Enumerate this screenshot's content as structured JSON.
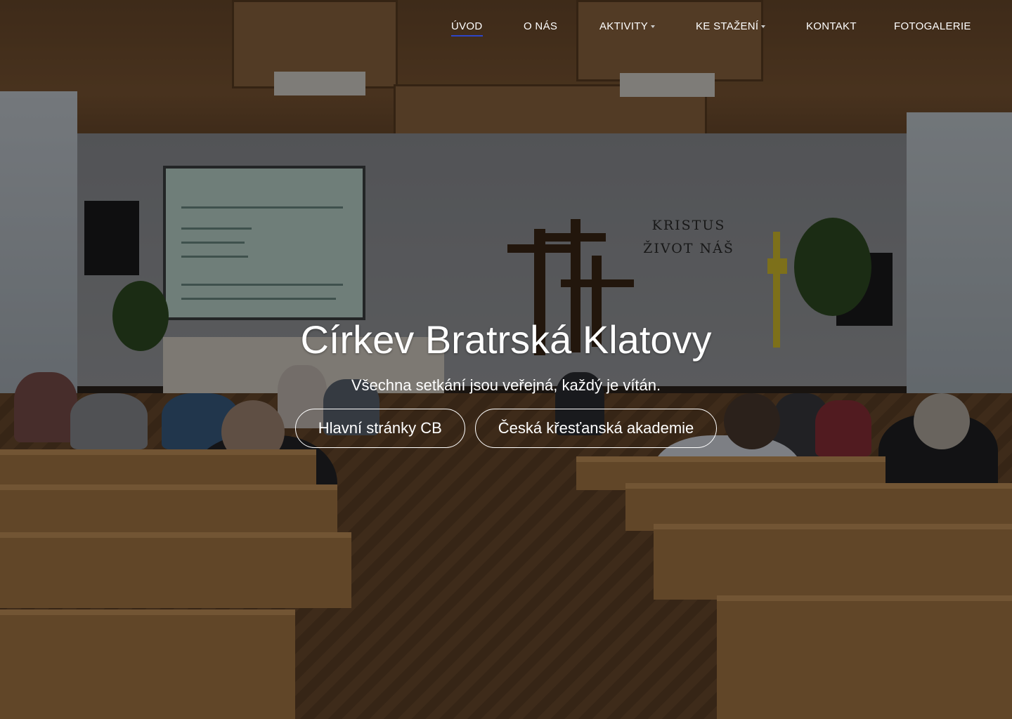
{
  "nav": {
    "items": [
      {
        "label": "ÚVOD",
        "active": true,
        "dropdown": false
      },
      {
        "label": "O NÁS",
        "active": false,
        "dropdown": false
      },
      {
        "label": "AKTIVITY",
        "active": false,
        "dropdown": true
      },
      {
        "label": "KE STAŽENÍ",
        "active": false,
        "dropdown": true
      },
      {
        "label": "KONTAKT",
        "active": false,
        "dropdown": false
      },
      {
        "label": "FOTOGALERIE",
        "active": false,
        "dropdown": false
      }
    ]
  },
  "hero": {
    "title": "Církev Bratrská Klatovy",
    "subtitle": "Všechna setkání jsou veřejná, každý je vítán.",
    "buttons": [
      {
        "label": "Hlavní stránky CB"
      },
      {
        "label": "Česká křesťanská akademie"
      }
    ],
    "background_wall_text": [
      "KRISTUS",
      "ŽIVOT NÁŠ"
    ]
  },
  "colors": {
    "active_underline": "#2d46c9",
    "text": "#ffffff",
    "overlay": "rgba(0,0,0,0.42)"
  }
}
